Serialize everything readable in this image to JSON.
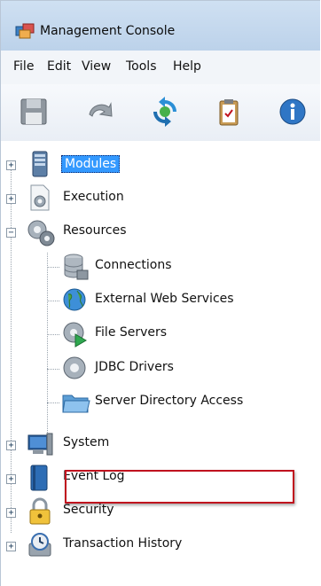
{
  "window": {
    "title": "Management Console"
  },
  "menu": [
    "File",
    "Edit",
    "View",
    "Tools",
    "Help"
  ],
  "toolbar": [
    {
      "icon": "save-icon"
    },
    {
      "icon": "undo-icon"
    },
    {
      "icon": "refresh-icon"
    },
    {
      "icon": "clipboard-icon"
    },
    {
      "icon": "info-icon"
    }
  ],
  "tree": {
    "root_items": [
      "Modules",
      "Execution",
      "Resources",
      "System",
      "Event Log",
      "Security",
      "Transaction History"
    ],
    "resources_children": [
      "Connections",
      "External Web Services",
      "File Servers",
      "JDBC Drivers",
      "Server Directory Access"
    ],
    "selected": "Modules",
    "highlighted": "Server Directory Access"
  },
  "colors": {
    "selection": "#3399ff",
    "highlight_border": "#c0121e"
  }
}
